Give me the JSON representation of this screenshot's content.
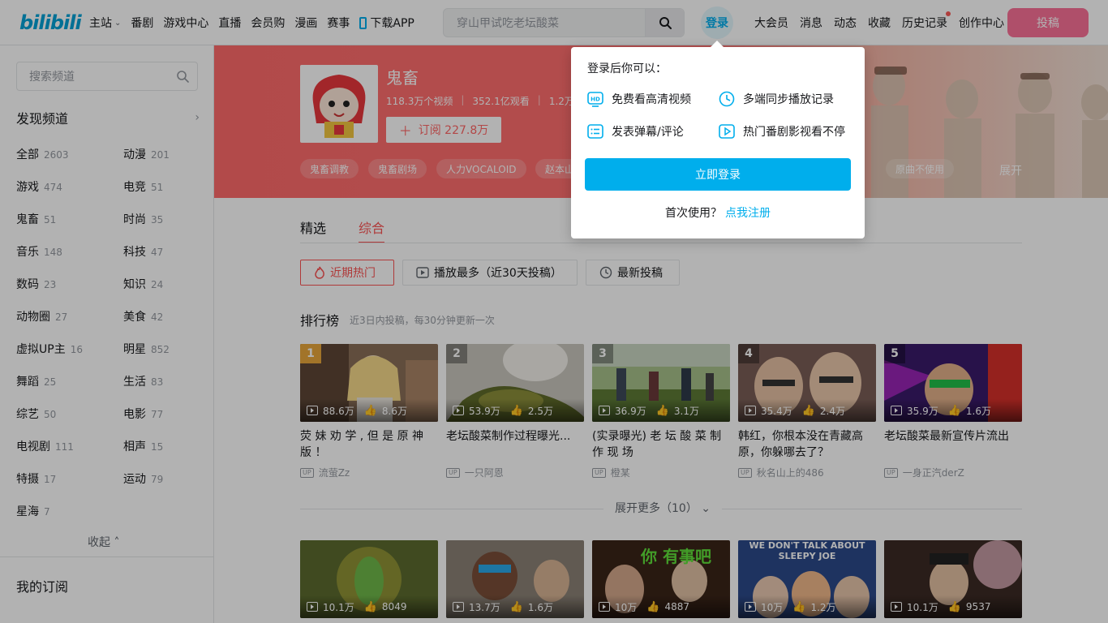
{
  "header": {
    "logo": "bilibili",
    "nav_left": [
      "主站",
      "番剧",
      "游戏中心",
      "直播",
      "会员购",
      "漫画",
      "赛事"
    ],
    "download_app": "下载APP",
    "search_placeholder": "穿山甲试吃老坛酸菜",
    "login": "登录",
    "nav_right": [
      "大会员",
      "消息",
      "动态",
      "收藏",
      "历史记录",
      "创作中心"
    ],
    "upload": "投稿",
    "accent": "#00aeec",
    "upload_color": "#fb7299"
  },
  "sidebar": {
    "search_placeholder": "搜索频道",
    "discover": "发现频道",
    "categories": [
      {
        "name": "全部",
        "count": "2603"
      },
      {
        "name": "动漫",
        "count": "201"
      },
      {
        "name": "游戏",
        "count": "474"
      },
      {
        "name": "电竞",
        "count": "51"
      },
      {
        "name": "鬼畜",
        "count": "51"
      },
      {
        "name": "时尚",
        "count": "35"
      },
      {
        "name": "音乐",
        "count": "148"
      },
      {
        "name": "科技",
        "count": "47"
      },
      {
        "name": "数码",
        "count": "23"
      },
      {
        "name": "知识",
        "count": "24"
      },
      {
        "name": "动物圈",
        "count": "27"
      },
      {
        "name": "美食",
        "count": "42"
      },
      {
        "name": "虚拟UP主",
        "count": "16"
      },
      {
        "name": "明星",
        "count": "852"
      },
      {
        "name": "舞蹈",
        "count": "25"
      },
      {
        "name": "生活",
        "count": "83"
      },
      {
        "name": "综艺",
        "count": "50"
      },
      {
        "name": "电影",
        "count": "77"
      },
      {
        "name": "电视剧",
        "count": "111"
      },
      {
        "name": "相声",
        "count": "15"
      },
      {
        "name": "特摄",
        "count": "17"
      },
      {
        "name": "运动",
        "count": "79"
      },
      {
        "name": "星海",
        "count": "7"
      }
    ],
    "collapse": "收起",
    "my_subscriptions": "我的订阅"
  },
  "channel": {
    "name": "鬼畜",
    "videos": "118.3万个视频",
    "views": "352.1亿观看",
    "extra": "1.2万个",
    "subscribe": "订阅 227.8万",
    "tags": [
      "鬼畜调教",
      "鬼畜剧场",
      "人力VOCALOID",
      "赵本山",
      "原曲不使用"
    ],
    "expand": "展开",
    "banner_color": "#ff6b6b"
  },
  "main": {
    "tabs": [
      "精选",
      "综合"
    ],
    "active_tab": "综合",
    "filters": [
      "近期热门",
      "播放最多（近30天投稿）",
      "最新投稿"
    ],
    "rank_title": "排行榜",
    "rank_note": "近3日内投稿，每30分钟更新一次",
    "ranked": [
      {
        "rank": "1",
        "plays": "88.6万",
        "likes": "8.6万",
        "title": "荧 妹 劝 学 , 但 是 原 神 版 ！",
        "up": "流萤Zz"
      },
      {
        "rank": "2",
        "plays": "53.9万",
        "likes": "2.5万",
        "title": "老坛酸菜制作过程曝光...",
        "up": "一只阿恩"
      },
      {
        "rank": "3",
        "plays": "36.9万",
        "likes": "3.1万",
        "title": "(实录曝光) 老 坛 酸 菜 制 作 现 场",
        "up": "橙某"
      },
      {
        "rank": "4",
        "plays": "35.4万",
        "likes": "2.4万",
        "title": "韩红，你根本没在青藏高原，你躲哪去了？",
        "up": "秋名山上的486"
      },
      {
        "rank": "5",
        "plays": "35.9万",
        "likes": "1.6万",
        "title": "老坛酸菜最新宣传片流出",
        "up": "一身正汽derZ"
      }
    ],
    "expand_more": "展开更多（10）",
    "second_row": [
      {
        "plays": "10.1万",
        "likes": "8049"
      },
      {
        "plays": "13.7万",
        "likes": "1.6万"
      },
      {
        "plays": "10万",
        "likes": "4887"
      },
      {
        "plays": "10万",
        "likes": "1.2万"
      },
      {
        "plays": "10.1万",
        "likes": "9537"
      }
    ],
    "thumb_texts": {
      "t2_1": "你 有事吧",
      "t2_2": "WE DON'T TALK ABOUT SLEEPY JOE"
    }
  },
  "login_popover": {
    "title": "登录后你可以：",
    "perks": [
      "免费看高清视频",
      "多端同步播放记录",
      "发表弹幕/评论",
      "热门番剧影视看不停"
    ],
    "login_button": "立即登录",
    "first_use": "首次使用？",
    "register": "点我注册"
  }
}
